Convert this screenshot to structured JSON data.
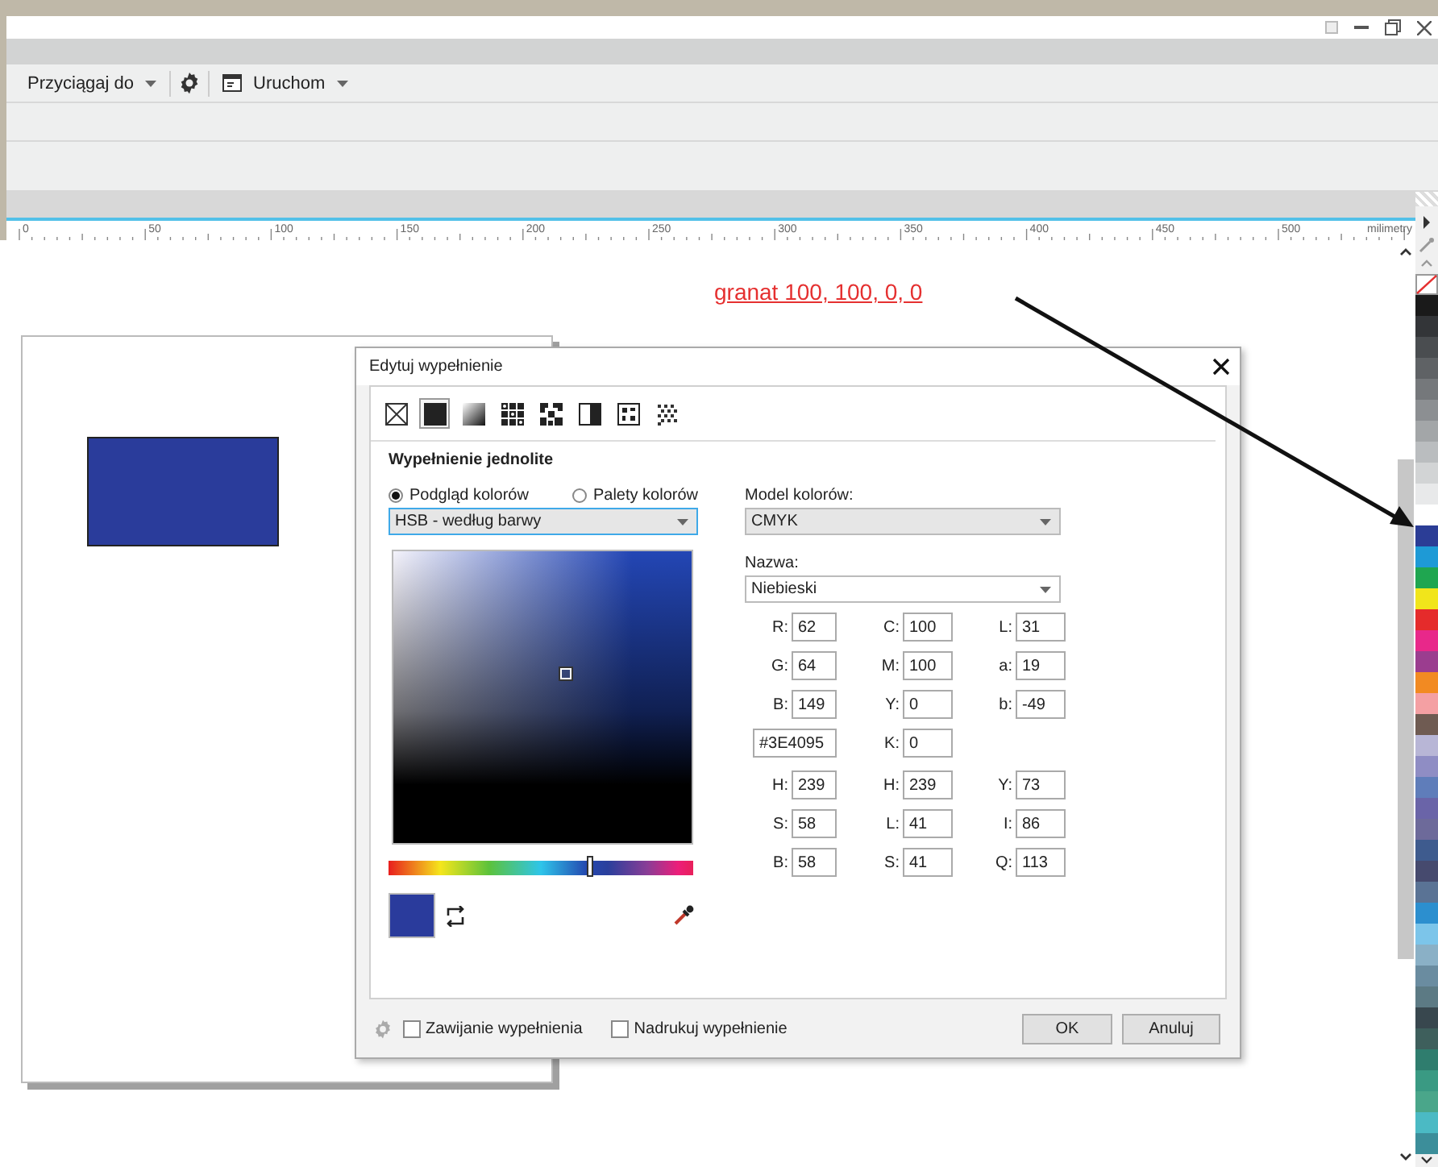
{
  "toolbar": {
    "snap_label": "Przyciągaj do",
    "launch_label": "Uruchom"
  },
  "ruler": {
    "labels": [
      "0",
      "50",
      "100",
      "150",
      "200",
      "250",
      "300",
      "350",
      "400",
      "450",
      "500"
    ],
    "unit": "milimetry"
  },
  "annotation": "granat 100, 100, 0, 0",
  "dialog": {
    "title": "Edytuj wypełnienie",
    "fill_types": [
      {
        "kind": "none",
        "selected": false
      },
      {
        "kind": "uniform",
        "selected": true
      },
      {
        "kind": "fountain",
        "selected": false
      },
      {
        "kind": "vector",
        "selected": false
      },
      {
        "kind": "bitmap",
        "selected": false
      },
      {
        "kind": "two-color",
        "selected": false
      },
      {
        "kind": "pattern",
        "selected": false
      },
      {
        "kind": "texture",
        "selected": false
      }
    ],
    "section_title": "Wypełnienie jednolite",
    "view_modes": [
      {
        "label": "Podgląd kolorów",
        "selected": true
      },
      {
        "label": "Palety kolorów",
        "selected": false
      }
    ],
    "view_dropdown": {
      "value": "HSB - według barwy",
      "focused": true
    },
    "hue_slider": {
      "level": 0.66
    },
    "color_model_label": "Model kolorów:",
    "color_model": "CMYK",
    "name_label": "Nazwa:",
    "name": "Niebieski",
    "value_blocks": [
      {
        "rows": [
          {
            "cells": [
              {
                "kind": "field",
                "label": "R:",
                "value": "62"
              },
              {
                "kind": "field",
                "label": "C:",
                "value": "100"
              },
              {
                "kind": "field",
                "label": "L:",
                "value": "31"
              }
            ]
          },
          {
            "cells": [
              {
                "kind": "field",
                "label": "G:",
                "value": "64"
              },
              {
                "kind": "field",
                "label": "M:",
                "value": "100"
              },
              {
                "kind": "field",
                "label": "a:",
                "value": "19"
              }
            ]
          },
          {
            "cells": [
              {
                "kind": "field",
                "label": "B:",
                "value": "149"
              },
              {
                "kind": "field",
                "label": "Y:",
                "value": "0"
              },
              {
                "kind": "field",
                "label": "b:",
                "value": "-49"
              }
            ]
          },
          {
            "cells": [
              {
                "kind": "hex",
                "value": "#3E4095"
              },
              {
                "kind": "field",
                "label": "K:",
                "value": "0"
              }
            ]
          }
        ]
      },
      {
        "rows": [
          {
            "cells": [
              {
                "kind": "field",
                "label": "H:",
                "value": "239"
              },
              {
                "kind": "field",
                "label": "H:",
                "value": "239"
              },
              {
                "kind": "field",
                "label": "Y:",
                "value": "73"
              }
            ]
          },
          {
            "cells": [
              {
                "kind": "field",
                "label": "S:",
                "value": "58"
              },
              {
                "kind": "field",
                "label": "L:",
                "value": "41"
              },
              {
                "kind": "field",
                "label": "I:",
                "value": "86"
              }
            ]
          },
          {
            "cells": [
              {
                "kind": "field",
                "label": "B:",
                "value": "58"
              },
              {
                "kind": "field",
                "label": "S:",
                "value": "41"
              },
              {
                "kind": "field",
                "label": "Q:",
                "value": "113"
              }
            ]
          }
        ]
      }
    ],
    "options": [
      {
        "label": "Zawijanie wypełnienia",
        "checked": false
      },
      {
        "label": "Nadrukuj wypełnienie",
        "checked": false
      }
    ],
    "buttons": [
      "OK",
      "Anuluj"
    ]
  },
  "palette": [
    {
      "color": "#1a1a1a"
    },
    {
      "color": "#333538"
    },
    {
      "color": "#4a4d50"
    },
    {
      "color": "#5f6265"
    },
    {
      "color": "#75787b"
    },
    {
      "color": "#8c8f92"
    },
    {
      "color": "#a3a6a8"
    },
    {
      "color": "#babdbf"
    },
    {
      "color": "#d2d4d5"
    },
    {
      "color": "#e8e9ea"
    },
    {
      "color": "#ffffff"
    },
    {
      "color": "#2b3d96"
    },
    {
      "color": "#1e9ad6"
    },
    {
      "color": "#1fa650"
    },
    {
      "color": "#f1e51b"
    },
    {
      "color": "#e52b2b"
    },
    {
      "color": "#e8288a"
    },
    {
      "color": "#9b3d8f"
    },
    {
      "color": "#f28a22"
    },
    {
      "color": "#f4a0a3"
    },
    {
      "color": "#6f5b52"
    },
    {
      "color": "#b8b6d6"
    },
    {
      "color": "#8f8dc4"
    },
    {
      "color": "#5f7dba"
    },
    {
      "color": "#6a64a8"
    },
    {
      "color": "#6d6a9a"
    },
    {
      "color": "#3e5b8e"
    },
    {
      "color": "#464a6e"
    },
    {
      "color": "#5a7395"
    },
    {
      "color": "#2c8fcf"
    },
    {
      "color": "#7cc5ea"
    },
    {
      "color": "#8ab0c6"
    },
    {
      "color": "#6a8ca0"
    },
    {
      "color": "#5c7a84"
    },
    {
      "color": "#38474e"
    },
    {
      "color": "#3e5f5c"
    },
    {
      "color": "#2f7d6e"
    },
    {
      "color": "#3a9a83"
    },
    {
      "color": "#4aa68a"
    },
    {
      "color": "#4bbac4"
    },
    {
      "color": "#3c8e9a"
    }
  ]
}
